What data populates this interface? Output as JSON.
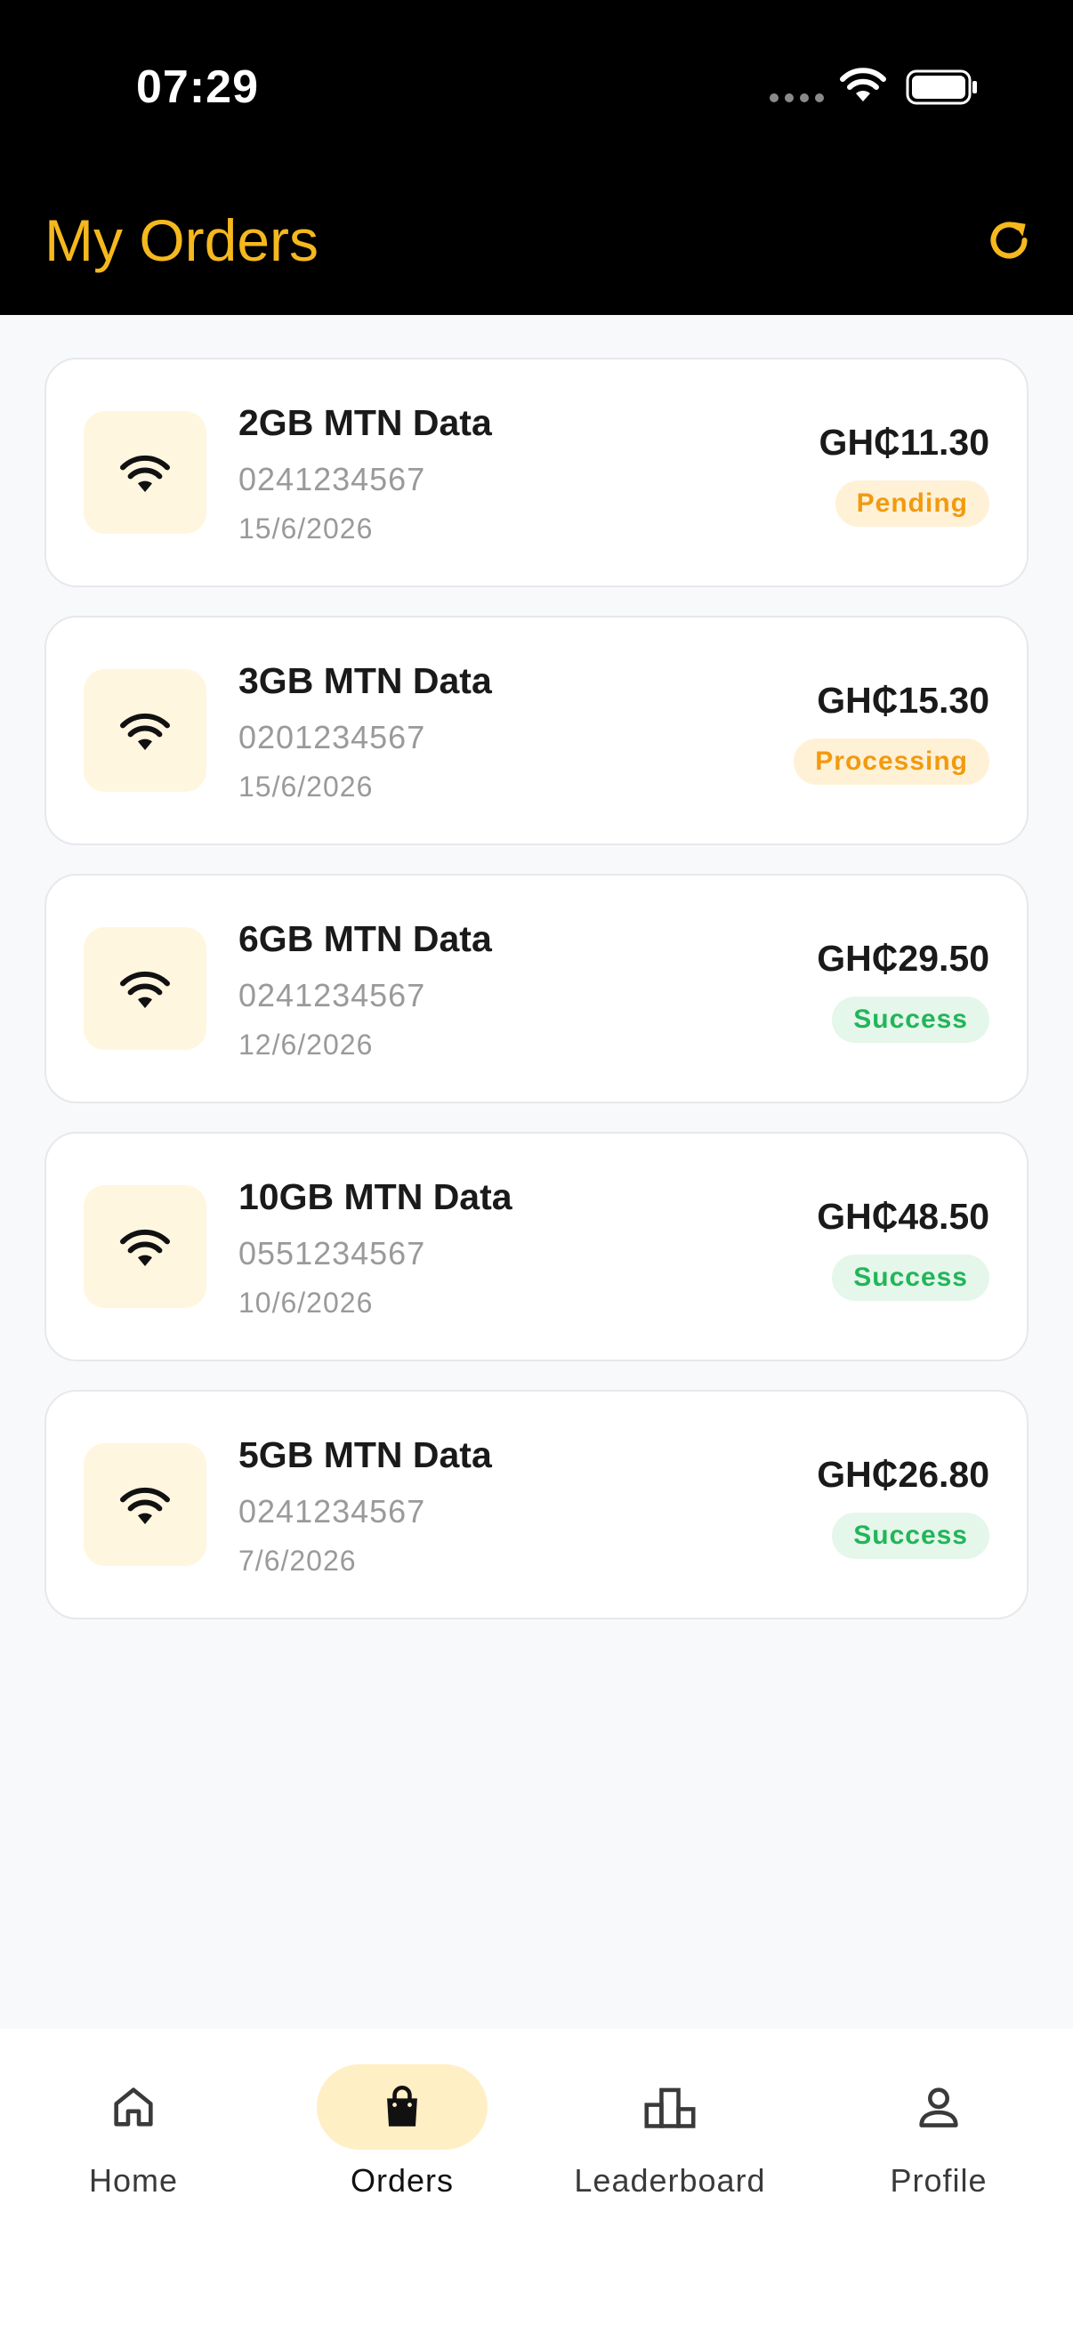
{
  "status_bar": {
    "time": "07:29"
  },
  "header": {
    "title": "My Orders"
  },
  "colors": {
    "accent": "#F5B81D",
    "pending_text": "#F29A0E",
    "pending_bg": "#FFF1D6",
    "success_text": "#22B55A",
    "success_bg": "#E4F7EA",
    "icon_bg": "#FFF6DF"
  },
  "icons": {
    "refresh": "refresh-icon",
    "order": "wifi-icon",
    "home": "home-icon",
    "orders": "shopping-bag-icon",
    "leaderboard": "leaderboard-icon",
    "profile": "profile-icon"
  },
  "orders": [
    {
      "title": "2GB MTN Data",
      "phone": "0241234567",
      "date": "15/6/2026",
      "price": "GH₵11.30",
      "status": "Pending"
    },
    {
      "title": "3GB MTN Data",
      "phone": "0201234567",
      "date": "15/6/2026",
      "price": "GH₵15.30",
      "status": "Processing"
    },
    {
      "title": "6GB MTN Data",
      "phone": "0241234567",
      "date": "12/6/2026",
      "price": "GH₵29.50",
      "status": "Success"
    },
    {
      "title": "10GB MTN Data",
      "phone": "0551234567",
      "date": "10/6/2026",
      "price": "GH₵48.50",
      "status": "Success"
    },
    {
      "title": "5GB MTN Data",
      "phone": "0241234567",
      "date": "7/6/2026",
      "price": "GH₵26.80",
      "status": "Success"
    }
  ],
  "nav": {
    "items": [
      {
        "label": "Home"
      },
      {
        "label": "Orders"
      },
      {
        "label": "Leaderboard"
      },
      {
        "label": "Profile"
      }
    ],
    "active": "Orders"
  }
}
